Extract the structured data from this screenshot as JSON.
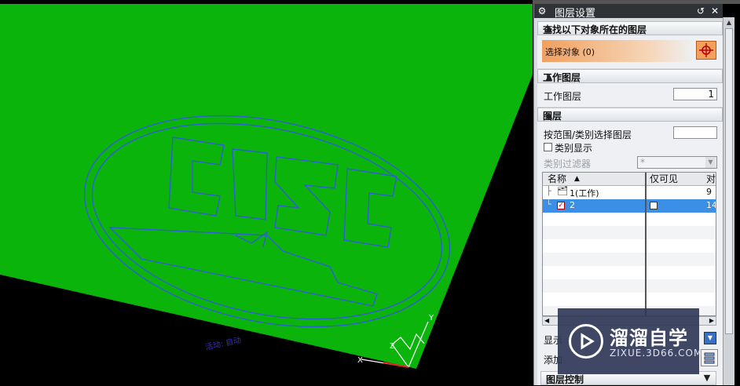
{
  "window": {
    "title": "图层设置"
  },
  "sections": {
    "find_layer": {
      "title": "查找以下对象所在的图层",
      "select_label": "选择对象 (0)"
    },
    "work_layer": {
      "title": "工作图层",
      "field_label": "工作图层",
      "field_value": "1"
    },
    "layers": {
      "title": "图层",
      "range_label": "按范围/类别选择图层",
      "range_value": "",
      "category_display_label": "类别显示",
      "category_filter_label": "类别过滤器",
      "category_filter_value": "*",
      "columns": [
        "名称",
        "仅可见",
        "对"
      ],
      "rows": [
        {
          "name": "1(工作)",
          "count": "9"
        },
        {
          "name": "2",
          "count": "14"
        }
      ]
    },
    "display_label": "显示",
    "add_label": "添加",
    "layer_control_label": "图层控制"
  },
  "viewport": {
    "label": "活动: 自动",
    "axis_x": "X",
    "axis_y": "Y",
    "axis_z": "Z"
  },
  "watermark": {
    "name": "溜溜自学",
    "url": "ZIXUE.3D66.COM"
  },
  "colors": {
    "surface": "#0bb40b",
    "outline": "#2f5fd6",
    "selection": "#3b8fe6",
    "accent_button": "#f08c3c"
  }
}
